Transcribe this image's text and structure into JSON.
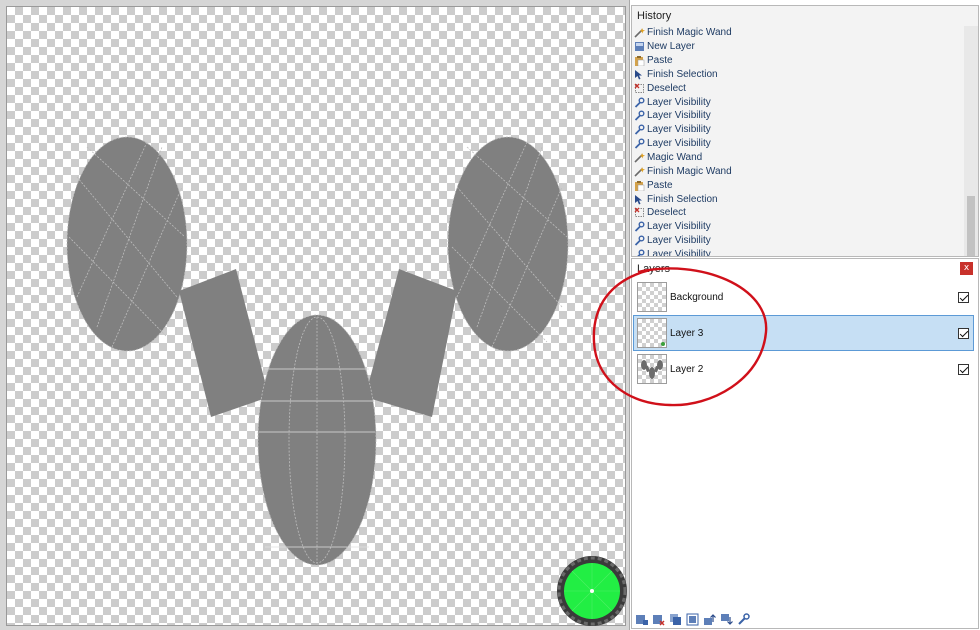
{
  "history": {
    "title": "History",
    "items": [
      {
        "label": "Finish Magic Wand",
        "icon": "magic-wand-icon"
      },
      {
        "label": "New Layer",
        "icon": "new-layer-icon"
      },
      {
        "label": "Paste",
        "icon": "paste-icon"
      },
      {
        "label": "Finish Selection",
        "icon": "selection-icon"
      },
      {
        "label": "Deselect",
        "icon": "deselect-icon"
      },
      {
        "label": "Layer Visibility",
        "icon": "wrench-icon"
      },
      {
        "label": "Layer Visibility",
        "icon": "wrench-icon"
      },
      {
        "label": "Layer Visibility",
        "icon": "wrench-icon"
      },
      {
        "label": "Layer Visibility",
        "icon": "wrench-icon"
      },
      {
        "label": "Magic Wand",
        "icon": "magic-wand-icon"
      },
      {
        "label": "Finish Magic Wand",
        "icon": "magic-wand-icon"
      },
      {
        "label": "Paste",
        "icon": "paste-icon"
      },
      {
        "label": "Finish Selection",
        "icon": "selection-icon"
      },
      {
        "label": "Deselect",
        "icon": "deselect-icon"
      },
      {
        "label": "Layer Visibility",
        "icon": "wrench-icon"
      },
      {
        "label": "Layer Visibility",
        "icon": "wrench-icon"
      },
      {
        "label": "Layer Visibility",
        "icon": "wrench-icon"
      }
    ]
  },
  "layers": {
    "title": "Layers",
    "close_label": "x",
    "items": [
      {
        "name": "Background",
        "visible": true,
        "selected": false
      },
      {
        "name": "Layer 3",
        "visible": true,
        "selected": true
      },
      {
        "name": "Layer 2",
        "visible": true,
        "selected": false
      }
    ],
    "toolbar_icons": [
      "add-layer-icon",
      "delete-layer-icon",
      "duplicate-layer-icon",
      "merge-layer-icon",
      "move-layer-up-icon",
      "move-layer-down-icon",
      "layer-properties-icon"
    ]
  },
  "colors": {
    "annotation": "#d0101a",
    "shape_fill": "#808080",
    "primary_color": "#22ee44",
    "selection_highlight": "#c6dff4"
  }
}
